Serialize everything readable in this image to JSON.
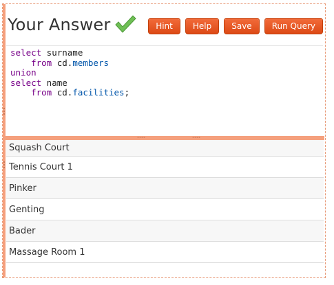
{
  "header": {
    "title": "Your Answer",
    "check_icon": "check-mark-icon",
    "check_color": "#5cb85c"
  },
  "toolbar": {
    "hint_label": "Hint",
    "help_label": "Help",
    "save_label": "Save",
    "run_label": "Run Query",
    "button_color": "#e8541f"
  },
  "editor": {
    "lines": [
      [
        {
          "t": "kw",
          "v": "select"
        },
        {
          "t": "plain",
          "v": " surname"
        }
      ],
      [
        {
          "t": "plain",
          "v": "    "
        },
        {
          "t": "kw",
          "v": "from"
        },
        {
          "t": "plain",
          "v": " cd."
        },
        {
          "t": "prop",
          "v": "members"
        }
      ],
      [
        {
          "t": "kw",
          "v": "union"
        }
      ],
      [
        {
          "t": "kw",
          "v": "select"
        },
        {
          "t": "plain",
          "v": " name"
        }
      ],
      [
        {
          "t": "plain",
          "v": "    "
        },
        {
          "t": "kw",
          "v": "from"
        },
        {
          "t": "plain",
          "v": " cd."
        },
        {
          "t": "prop",
          "v": "facilities"
        },
        {
          "t": "plain",
          "v": ";"
        }
      ]
    ]
  },
  "results": {
    "rows": [
      "Squash Court",
      "Tennis Court 1",
      "Pinker",
      "Genting",
      "Bader",
      "Massage Room 1"
    ]
  },
  "colors": {
    "accent": "#f5a07d",
    "keyword": "#770088",
    "property": "#0055aa"
  }
}
